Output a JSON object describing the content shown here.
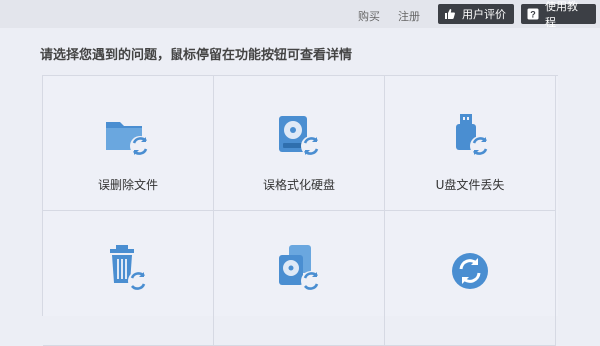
{
  "topbar": {
    "links": [
      {
        "label": "购买",
        "icon": null
      },
      {
        "label": "注册",
        "icon": null
      }
    ],
    "buttons": [
      {
        "label": "用户评价",
        "icon": "thumbs-up-icon"
      },
      {
        "label": "使用教程",
        "icon": "help-icon"
      }
    ]
  },
  "main": {
    "prompt": "请选择您遇到的问题，鼠标停留在功能按钮可查看详情",
    "tiles": [
      {
        "label": "误删除文件",
        "icon": "folder-recover-icon"
      },
      {
        "label": "误格式化硬盘",
        "icon": "disk-recover-icon"
      },
      {
        "label": "U盘文件丢失",
        "icon": "usb-recover-icon"
      },
      {
        "label": "",
        "icon": "trash-recover-icon"
      },
      {
        "label": "",
        "icon": "partition-recover-icon"
      },
      {
        "label": "",
        "icon": "recover-icon"
      }
    ]
  },
  "colors": {
    "accent": "#4a8ed1",
    "topbar_button_bg": "#3c3f45",
    "background": "#eceef5"
  }
}
